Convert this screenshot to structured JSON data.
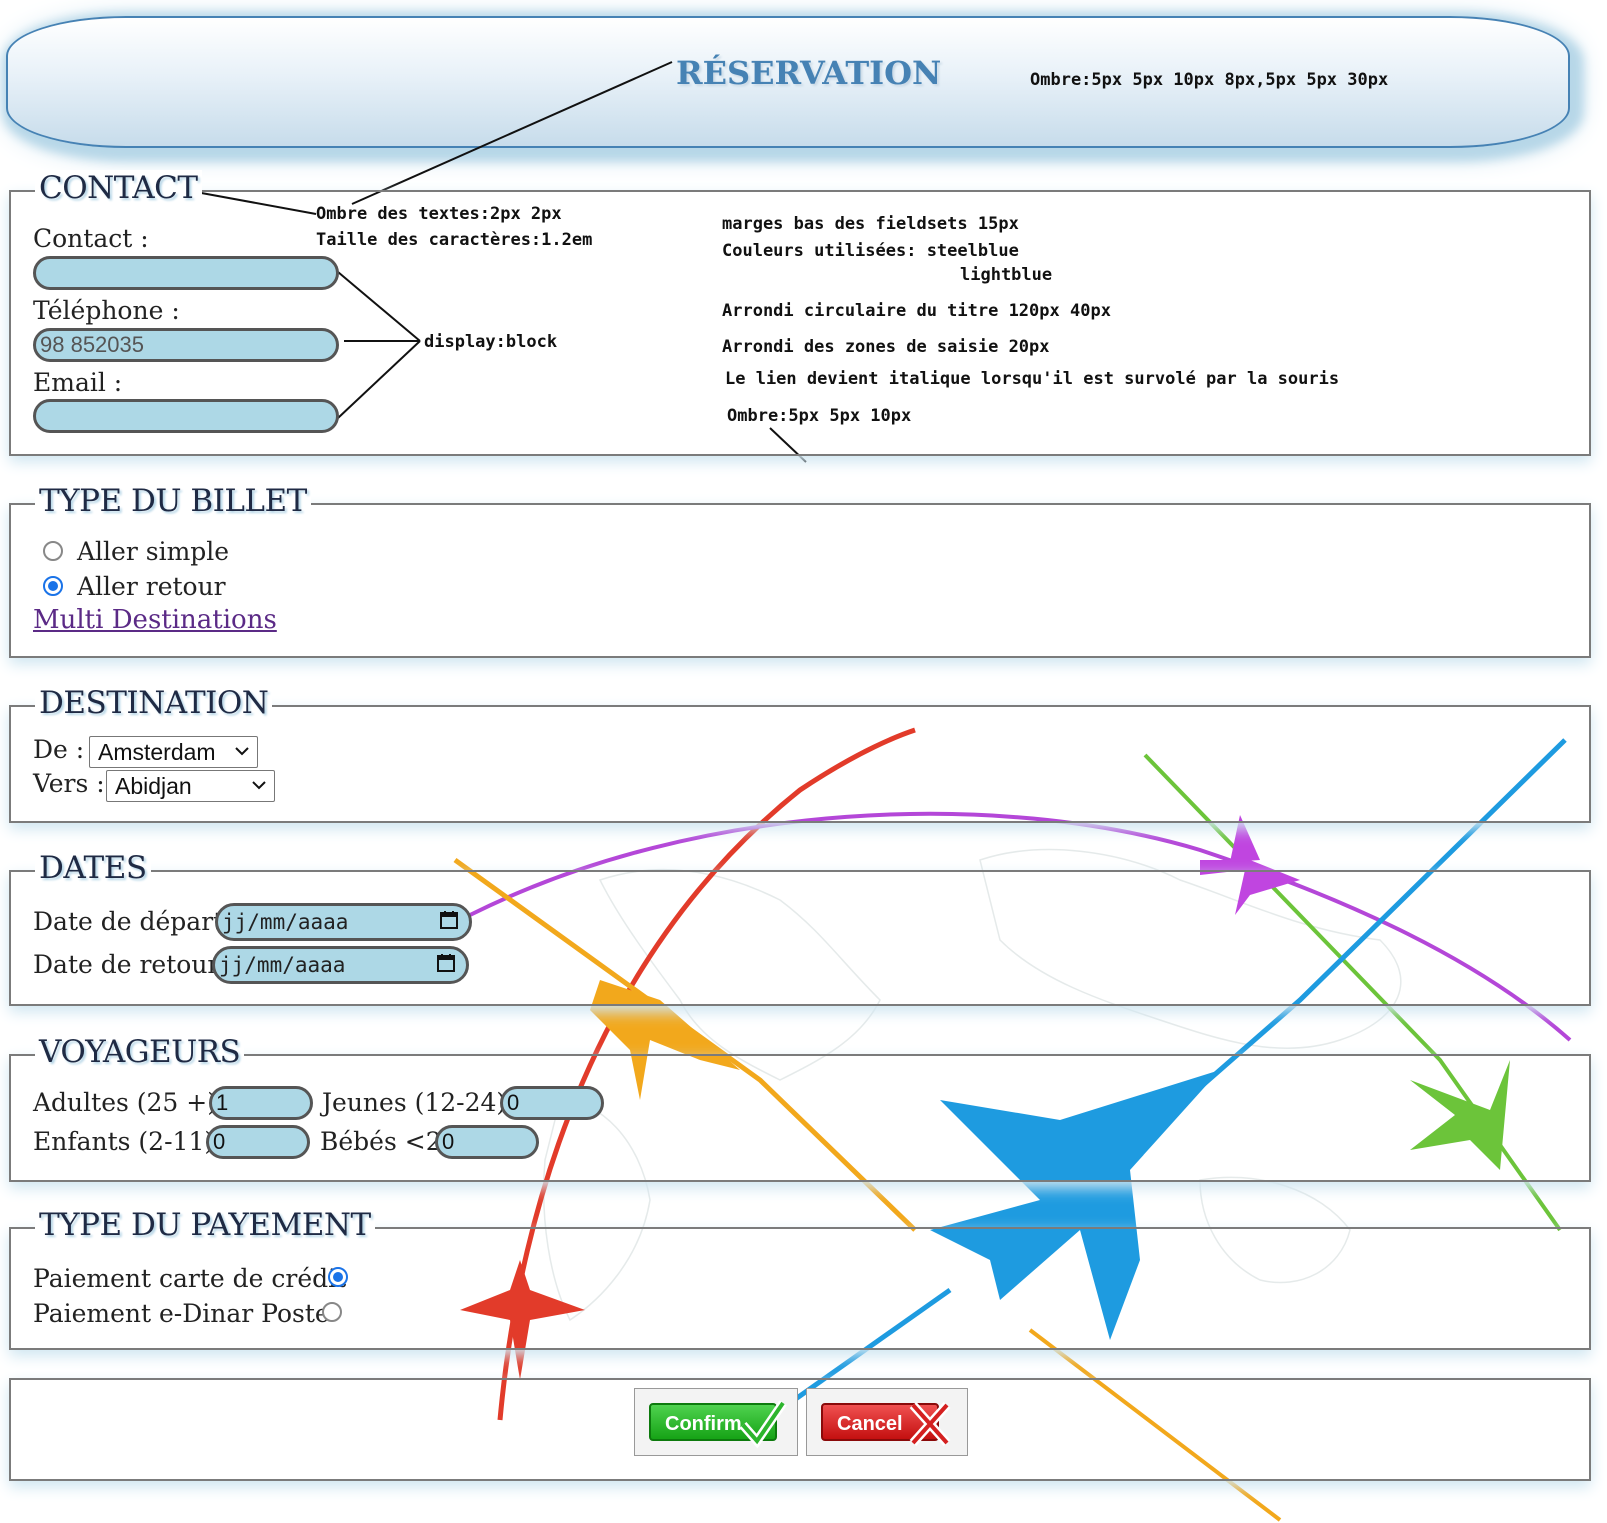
{
  "header": {
    "title": "RÉSERVATION",
    "shadow_note": "Ombre:5px 5px 10px 8px,5px 5px 30px"
  },
  "notes": {
    "text_shadow": "Ombre des textes:2px 2px",
    "font_size": "Taille des caractères:1.2em",
    "display_block": "display:block",
    "fieldset_margin": "marges bas des fieldsets 15px",
    "colors_line1": "Couleurs utilisées: steelblue",
    "colors_line2": "lightblue",
    "title_radius": "Arrondi circulaire du titre 120px 40px",
    "input_radius": "Arrondi des zones de saisie 20px",
    "link_hover": "Le lien devient italique lorsqu'il est survolé par la souris",
    "shadow_small": "Ombre:5px 5px 10px"
  },
  "contact": {
    "legend": "CONTACT",
    "contact_label": "Contact :",
    "contact_value": "",
    "phone_label": "Téléphone :",
    "phone_placeholder": "98 852035",
    "email_label": "Email :",
    "email_value": ""
  },
  "ticket": {
    "legend": "TYPE DU BILLET",
    "option_one_way": "Aller simple",
    "option_round_trip": "Aller retour",
    "selected": "Aller retour",
    "multi_link": "Multi Destinations"
  },
  "destination": {
    "legend": "DESTINATION",
    "from_label": "De :",
    "from_value": "Amsterdam",
    "to_label": "Vers :",
    "to_value": "Abidjan"
  },
  "dates": {
    "legend": "DATES",
    "departure_label": "Date de départ:",
    "departure_value": "jj/mm/aaaa",
    "return_label": "Date de retour:",
    "return_value": "jj/mm/aaaa"
  },
  "travelers": {
    "legend": "VOYAGEURS",
    "adults_label": "Adultes (25 +)",
    "adults_value": "1",
    "youth_label": "Jeunes (12-24)",
    "youth_value": "0",
    "children_label": "Enfants (2-11)",
    "children_value": "0",
    "babies_label": "Bébés <2",
    "babies_value": "0"
  },
  "payment": {
    "legend": "TYPE DU PAYEMENT",
    "card_label": "Paiement carte de crédit",
    "edinar_label": "Paiement e-Dinar Poste",
    "selected": "Paiement carte de crédit"
  },
  "actions": {
    "confirm_label": "Confirm",
    "cancel_label": "Cancel"
  },
  "colors": {
    "accent": "#4682b4",
    "input_bg": "#add8e6"
  }
}
